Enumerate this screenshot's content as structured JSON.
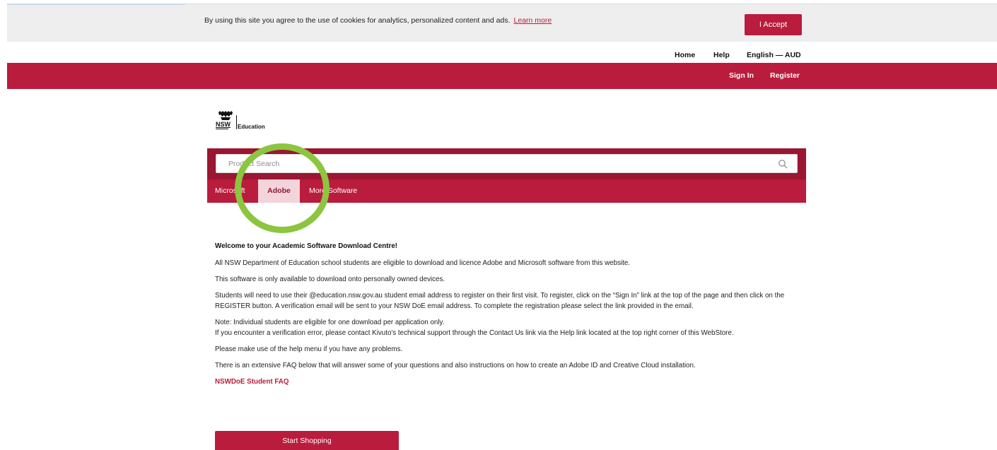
{
  "cookie_banner": {
    "text": "By using this site you agree to the use of cookies for analytics, personalized content and ads.",
    "learn_more": "Learn more",
    "accept_label": "I Accept"
  },
  "util_nav": {
    "home": "Home",
    "help": "Help",
    "language": "English — AUD"
  },
  "header": {
    "sign_in": "Sign In",
    "register": "Register"
  },
  "logo": {
    "org": "NSW",
    "dept": "Education"
  },
  "search": {
    "placeholder": "Product Search"
  },
  "tabs": [
    {
      "label": "Microsoft"
    },
    {
      "label": "Adobe"
    },
    {
      "label": "More Software"
    }
  ],
  "content": {
    "heading": "Welcome to your Academic Software Download Centre!",
    "p1": "All NSW Department of Education school students are eligible to download and licence Adobe and Microsoft software from this website.",
    "p2": "This software is only available to download onto personally owned devices.",
    "p3": "Students will need to use their @education.nsw.gov.au student email address to register on their first visit. To register, click on the “Sign In” link at the top of the page and then click on the REGISTER button. A verification email will be sent to your NSW DoE email address. To complete the registration please select the link provided in the email.",
    "p4a": "Note: Individual students are eligible for one download per application only.",
    "p4b": "If you encounter a verification error, please contact Kivuto's technical support through the Contact Us link via the Help link located at the top right corner of this WebStore.",
    "p5": "Please make use of the help menu if you have any problems.",
    "p6": "There is an extensive FAQ below that will answer some of your questions and also instructions on how to create an Adobe ID and Creative Cloud installation.",
    "faq_link": "NSWDoE Student FAQ",
    "start_button": "Start Shopping"
  },
  "colors": {
    "brand_red": "#b91c3c",
    "dark_red": "#9a1631",
    "active_tab_bg": "#f3d4db",
    "annotation_green": "#8cc53f"
  }
}
